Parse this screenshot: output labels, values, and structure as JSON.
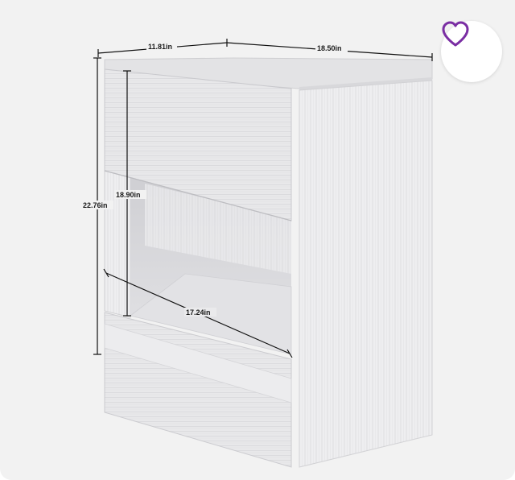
{
  "favorite": {
    "icon": "heart-outline-icon",
    "color": "#7a2ea3"
  },
  "dimensions": {
    "depth": "11.81in",
    "width": "18.50in",
    "total_height": "22.76in",
    "drawer_height": "18.90in",
    "inner_width": "17.24in"
  },
  "colors": {
    "background": "#f2f2f2",
    "cabinet_front": "#e9e9eb",
    "cabinet_side": "#f3f3f5",
    "cabinet_top": "#e2e2e4",
    "dimension_line": "#111111"
  }
}
